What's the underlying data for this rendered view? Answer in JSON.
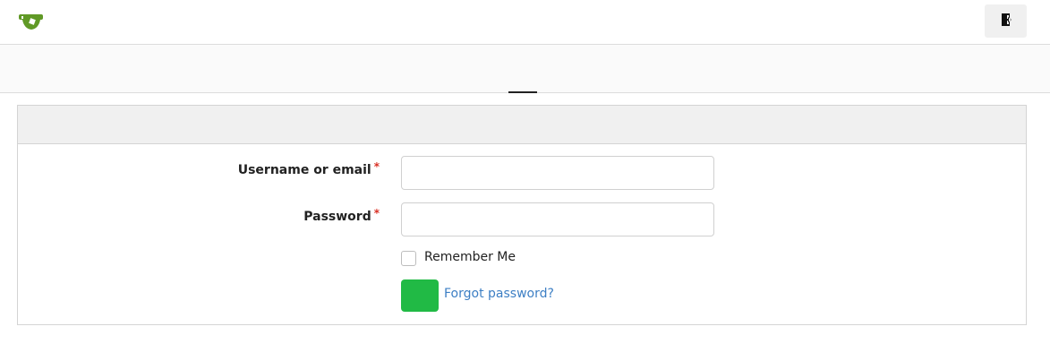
{
  "header": {
    "logo_icon": "teacup-logo-icon",
    "signin_icon": "sign-in-door-icon",
    "brand_color": "#609926"
  },
  "form": {
    "username_label": "Username or email",
    "password_label": "Password",
    "required_marker": "*",
    "username_value": "",
    "password_value": "",
    "remember_label": "Remember Me",
    "remember_checked": false,
    "submit_label": "",
    "forgot_link": "Forgot password?",
    "submit_color": "#21ba45",
    "link_color": "#3d7fc4"
  }
}
